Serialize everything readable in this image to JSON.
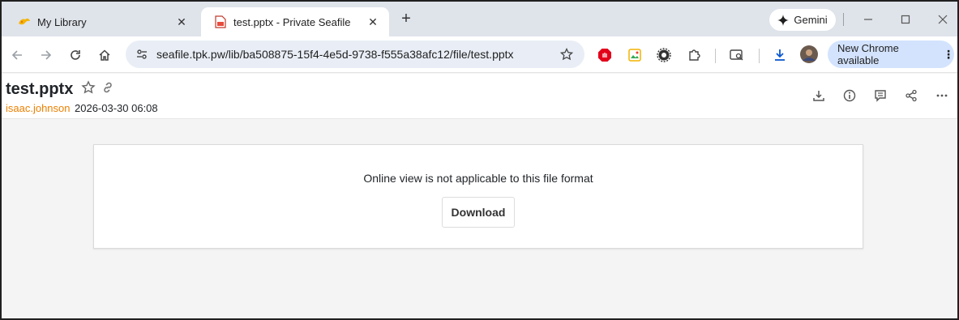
{
  "browser": {
    "tabs": [
      {
        "title": "My Library",
        "favicon": "seafile-logo-icon",
        "active": false
      },
      {
        "title": "test.pptx - Private Seafile",
        "favicon": "pptx-file-icon",
        "active": true
      }
    ],
    "gemini_label": "Gemini",
    "address_url": "seafile.tpk.pw/lib/ba508875-15f4-4e5d-9738-f555a38afc12/file/test.pptx",
    "update_label": "New Chrome available",
    "accent_color": "#d3e3fd"
  },
  "file": {
    "name": "test.pptx",
    "owner": "isaac.johnson",
    "modified": "2026-03-30 06:08"
  },
  "viewer": {
    "message": "Online view is not applicable to this file format",
    "download_label": "Download"
  },
  "colors": {
    "owner_link": "#ec8000",
    "page_bg": "#f4f4f4"
  }
}
